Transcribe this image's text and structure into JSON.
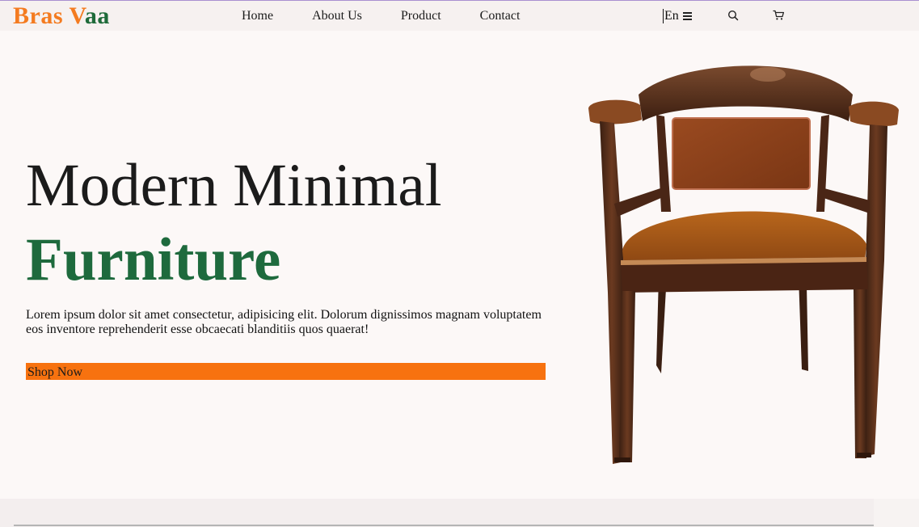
{
  "brand": {
    "part1": "Bras V",
    "part2": "aa",
    "colors": {
      "orange": "#f47b20",
      "green": "#1f6b3a"
    }
  },
  "nav": {
    "items": [
      {
        "label": "Home"
      },
      {
        "label": "About Us"
      },
      {
        "label": "Product"
      },
      {
        "label": "Contact"
      }
    ],
    "language": "En",
    "icons": {
      "menu": "hamburger-icon",
      "search": "search-icon",
      "cart": "cart-icon"
    }
  },
  "hero": {
    "title_line1": "Modern Minimal",
    "title_line2": "Furniture",
    "description": "Lorem ipsum dolor sit amet consectetur, adipisicing elit. Dolorum dignissimos magnam voluptatem eos inventore reprehenderit esse obcaecati blanditiis quos quaerat!",
    "cta_label": "Shop Now",
    "colors": {
      "title": "#1b1b1b",
      "accent": "#1e6a3d",
      "cta_bg": "#f7720f"
    }
  },
  "image": {
    "subject": "wooden-armchair"
  }
}
